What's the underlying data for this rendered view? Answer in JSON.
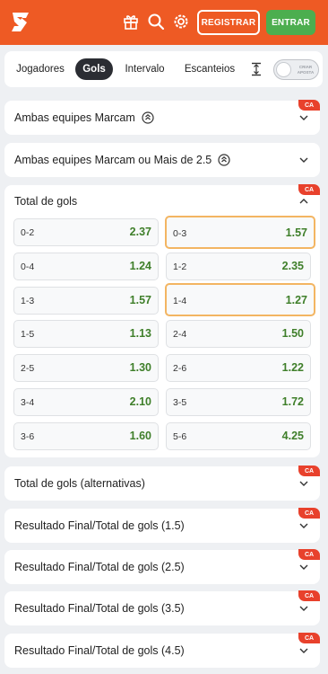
{
  "header": {
    "register_label": "REGISTRAR",
    "enter_label": "ENTRAR",
    "brand_color": "#ee5a24",
    "enter_color": "#4cae4f",
    "icons": [
      "gift-icon",
      "search-icon",
      "gear-icon"
    ]
  },
  "tabs": {
    "items": [
      "Jogadores",
      "Gols",
      "Intervalo",
      "Escanteios"
    ],
    "active": "Gols",
    "toggle_text": "CRIAR APOSTA"
  },
  "ca_badge": "CA",
  "markets": [
    {
      "title": "Ambas equipes Marcam",
      "expanded": false
    },
    {
      "title": "Ambas equipes Marcam ou Mais de 2.5",
      "expanded": false
    },
    {
      "title": "Total de gols",
      "expanded": true
    },
    {
      "title": "Total de gols (alternativas)",
      "expanded": false
    },
    {
      "title": "Resultado Final/Total de gols (1.5)",
      "expanded": false
    },
    {
      "title": "Resultado Final/Total de gols (2.5)",
      "expanded": false
    },
    {
      "title": "Resultado Final/Total de gols (3.5)",
      "expanded": false
    },
    {
      "title": "Resultado Final/Total de gols (4.5)",
      "expanded": false
    }
  ],
  "total_gols_odds": [
    {
      "label": "0-2",
      "value": "2.37",
      "selected": false
    },
    {
      "label": "0-3",
      "value": "1.57",
      "selected": true
    },
    {
      "label": "0-4",
      "value": "1.24",
      "selected": false
    },
    {
      "label": "1-2",
      "value": "2.35",
      "selected": false
    },
    {
      "label": "1-3",
      "value": "1.57",
      "selected": false
    },
    {
      "label": "1-4",
      "value": "1.27",
      "selected": true
    },
    {
      "label": "1-5",
      "value": "1.13",
      "selected": false
    },
    {
      "label": "2-4",
      "value": "1.50",
      "selected": false
    },
    {
      "label": "2-5",
      "value": "1.30",
      "selected": false
    },
    {
      "label": "2-6",
      "value": "1.22",
      "selected": false
    },
    {
      "label": "3-4",
      "value": "2.10",
      "selected": false
    },
    {
      "label": "3-5",
      "value": "1.72",
      "selected": false
    },
    {
      "label": "3-6",
      "value": "1.60",
      "selected": false
    },
    {
      "label": "5-6",
      "value": "4.25",
      "selected": false
    }
  ]
}
